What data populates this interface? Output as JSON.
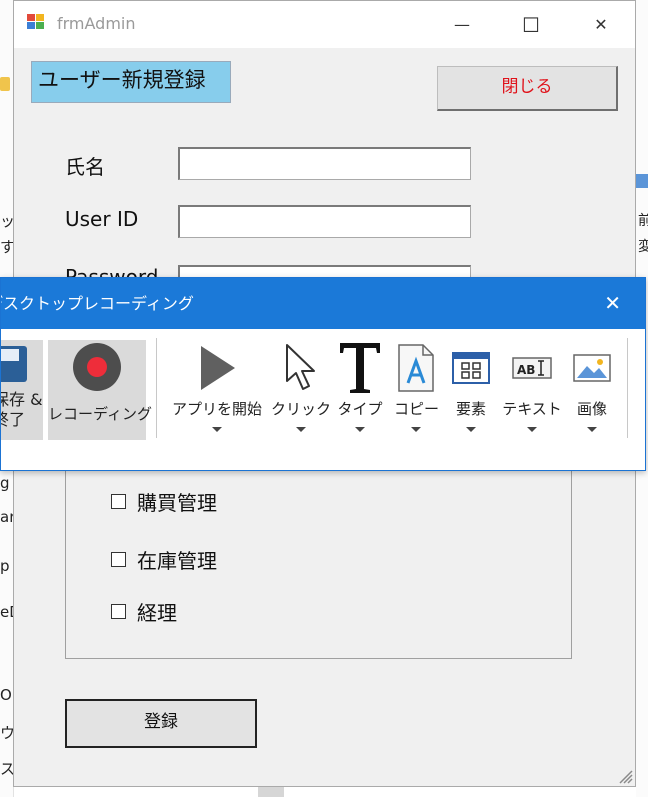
{
  "background": {
    "left_fragments": [
      "ッセ",
      "す",
      "g",
      "ara",
      "p",
      "eD",
      "O",
      "ウ",
      "ス"
    ],
    "right_fragments": [
      "前",
      "変"
    ]
  },
  "window": {
    "title": "frmAdmin",
    "minimize_glyph": "—",
    "maximize_glyph": "☐",
    "close_glyph": "✕",
    "header_label": "ユーザー新規登録",
    "close_button": "閉じる",
    "fields": {
      "name_label": "氏名",
      "name_value": "",
      "userid_label": "User ID",
      "userid_value": "",
      "password_label": "Password",
      "password_value": ""
    },
    "checkboxes": [
      {
        "label": "購買管理",
        "checked": false
      },
      {
        "label": "在庫管理",
        "checked": false
      },
      {
        "label": "経理",
        "checked": false
      }
    ],
    "register_button": "登録"
  },
  "recorder": {
    "title": "デスクトップレコーディング",
    "close_glyph": "✕",
    "save_label_1": "保存 &",
    "save_label_2": "終了",
    "record_label": "レコーディング",
    "tools": [
      {
        "label": "アプリを開始",
        "icon": "play-icon"
      },
      {
        "label": "クリック",
        "icon": "cursor-icon"
      },
      {
        "label": "タイプ",
        "icon": "type-icon"
      },
      {
        "label": "コピー",
        "icon": "copy-icon"
      },
      {
        "label": "要素",
        "icon": "element-icon"
      },
      {
        "label": "テキスト",
        "icon": "text-icon"
      },
      {
        "label": "画像",
        "icon": "image-icon"
      }
    ],
    "colors": {
      "titlebar": "#1b79d8",
      "record_dot": "#ee2d3a"
    }
  }
}
